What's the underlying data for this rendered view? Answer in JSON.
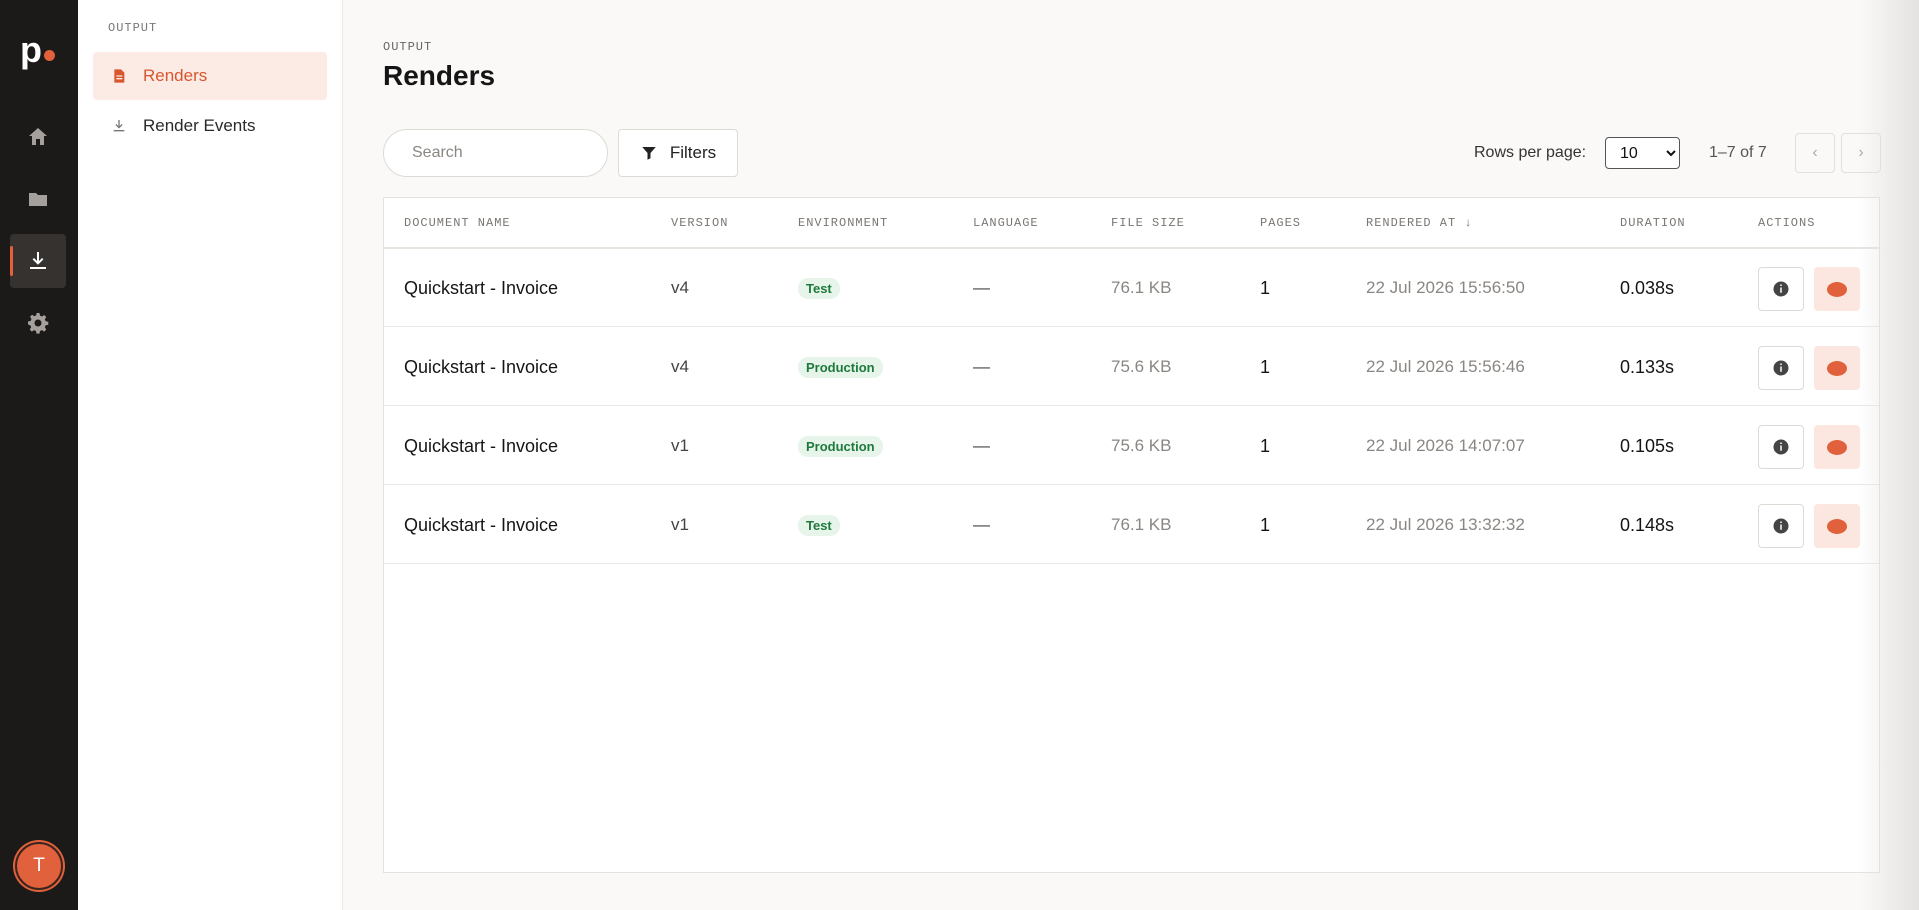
{
  "brand": {
    "logo_letter": "p"
  },
  "rail": {
    "items": [
      {
        "icon": "home-icon"
      },
      {
        "icon": "folder-icon"
      },
      {
        "icon": "download-icon",
        "active": true
      },
      {
        "icon": "gear-icon"
      }
    ],
    "avatar_initial": "T"
  },
  "subnav": {
    "section_label": "OUTPUT",
    "items": [
      {
        "label": "Renders",
        "icon": "document-icon",
        "active": true
      },
      {
        "label": "Render Events",
        "icon": "download-icon"
      }
    ]
  },
  "page": {
    "eyebrow": "OUTPUT",
    "title": "Renders"
  },
  "toolbar": {
    "search_placeholder": "Search",
    "filters_label": "Filters",
    "rows_per_page_label": "Rows per page:",
    "rows_per_page_value": "10",
    "page_info": "1–7 of 7"
  },
  "table": {
    "columns": [
      "DOCUMENT NAME",
      "VERSION",
      "ENVIRONMENT",
      "LANGUAGE",
      "FILE SIZE",
      "PAGES",
      "RENDERED AT ↓",
      "DURATION",
      "ACTIONS"
    ],
    "rows": [
      {
        "name": "Quickstart - Invoice",
        "version": "v4",
        "environment": "Test",
        "language": "—",
        "file_size": "76.1 KB",
        "pages": "1",
        "rendered_at": "22 Jul 2026 15:56:50",
        "duration": "0.038s"
      },
      {
        "name": "Quickstart - Invoice",
        "version": "v4",
        "environment": "Production",
        "language": "—",
        "file_size": "75.6 KB",
        "pages": "1",
        "rendered_at": "22 Jul 2026 15:56:46",
        "duration": "0.133s"
      },
      {
        "name": "Quickstart - Invoice",
        "version": "v1",
        "environment": "Production",
        "language": "—",
        "file_size": "75.6 KB",
        "pages": "1",
        "rendered_at": "22 Jul 2026 14:07:07",
        "duration": "0.105s"
      },
      {
        "name": "Quickstart - Invoice",
        "version": "v1",
        "environment": "Test",
        "language": "—",
        "file_size": "76.1 KB",
        "pages": "1",
        "rendered_at": "22 Jul 2026 13:32:32",
        "duration": "0.148s"
      }
    ]
  },
  "colors": {
    "accent": "#e0613b",
    "rail_bg": "#1c1a19",
    "badge_bg": "#e6f4ea",
    "badge_text": "#1e7a3c"
  }
}
